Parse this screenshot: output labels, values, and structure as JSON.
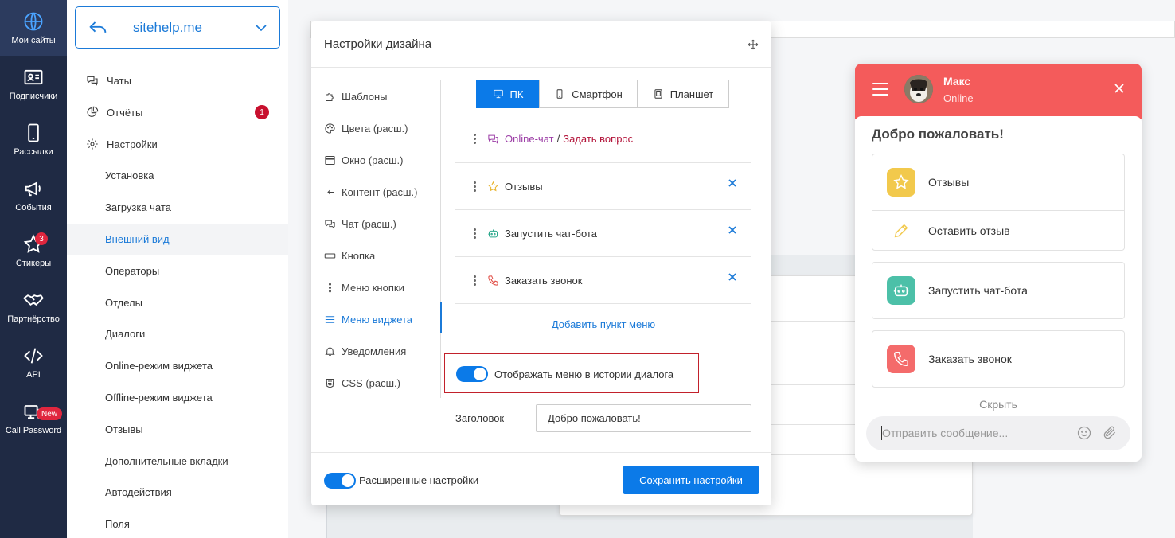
{
  "rail": [
    {
      "label": "Мои сайты",
      "icon": "globe-icon",
      "active": true
    },
    {
      "label": "Подписчики",
      "icon": "id-card-icon"
    },
    {
      "label": "Рассылки",
      "icon": "smartphone-icon"
    },
    {
      "label": "События",
      "icon": "megaphone-icon"
    },
    {
      "label": "Стикеры",
      "icon": "star-icon",
      "badge": "3"
    },
    {
      "label": "Партнёрство",
      "icon": "handshake-icon"
    },
    {
      "label": "API",
      "icon": "code-icon"
    },
    {
      "label": "Call Password",
      "icon": "computer-phone-icon",
      "badge": "New"
    }
  ],
  "site_select": {
    "name": "sitehelp.me"
  },
  "menu": {
    "chats": "Чаты",
    "reports": "Отчёты",
    "reports_badge": "1",
    "settings": "Настройки",
    "sub": [
      "Установка",
      "Загрузка чата",
      "Внешний вид",
      "Операторы",
      "Отделы",
      "Диалоги",
      "Online-режим виджета",
      "Offline-режим виджета",
      "Отзывы",
      "Дополнительные вкладки",
      "Автодействия",
      "Поля"
    ]
  },
  "panel": {
    "title": "Настройки дизайна",
    "tabs": [
      "Шаблоны",
      "Цвета (расш.)",
      "Окно (расш.)",
      "Контент (расш.)",
      "Чат (расш.)",
      "Кнопка",
      "Меню кнопки",
      "Меню виджета",
      "Уведомления",
      "CSS (расш.)"
    ],
    "devices": [
      "ПК",
      "Смартфон",
      "Планшет"
    ],
    "rows": {
      "online_chat": "Online-чат",
      "separator": "/",
      "ask": "Задать вопрос",
      "reviews": "Отзывы",
      "bot": "Запустить чат-бота",
      "call": "Заказать звонок"
    },
    "add_item": "Добавить пункт меню",
    "show_menu_label": "Отображать меню в истории диалога",
    "header_label": "Заголовок",
    "header_value": "Добро пожаловать!",
    "advanced_label": "Расширенные настройки",
    "save": "Сохранить настройки"
  },
  "widget": {
    "operator_name": "Макс",
    "status": "Online",
    "welcome": "Добро пожаловать!",
    "reviews": "Отзывы",
    "leave_review": "Оставить отзыв",
    "bot": "Запустить чат-бота",
    "call": "Заказать звонок",
    "hide": "Скрыть",
    "input_placeholder": "Отправить сообщение...",
    "colors": {
      "header": "#f45b5b",
      "star": "#f2c94c",
      "bot": "#4cc0a8",
      "call": "#f46b6b"
    }
  }
}
